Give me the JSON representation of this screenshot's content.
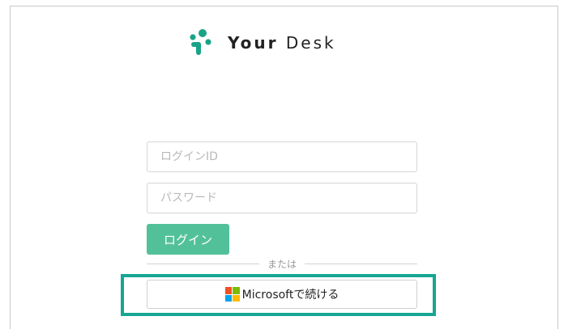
{
  "app": {
    "logo_part1": "Your",
    "logo_part2": "Desk",
    "brand_color": "#1aa387"
  },
  "form": {
    "login_id_placeholder": "ログインID",
    "password_placeholder": "パスワード",
    "login_button": "ログイン",
    "divider_text": "または",
    "microsoft_button": "Microsoftで続ける"
  },
  "colors": {
    "login_button_bg": "#52c19a",
    "highlight_border": "#16a694",
    "ms_red": "#f25022",
    "ms_green": "#7fba00",
    "ms_blue": "#00a4ef",
    "ms_yellow": "#ffb900"
  }
}
